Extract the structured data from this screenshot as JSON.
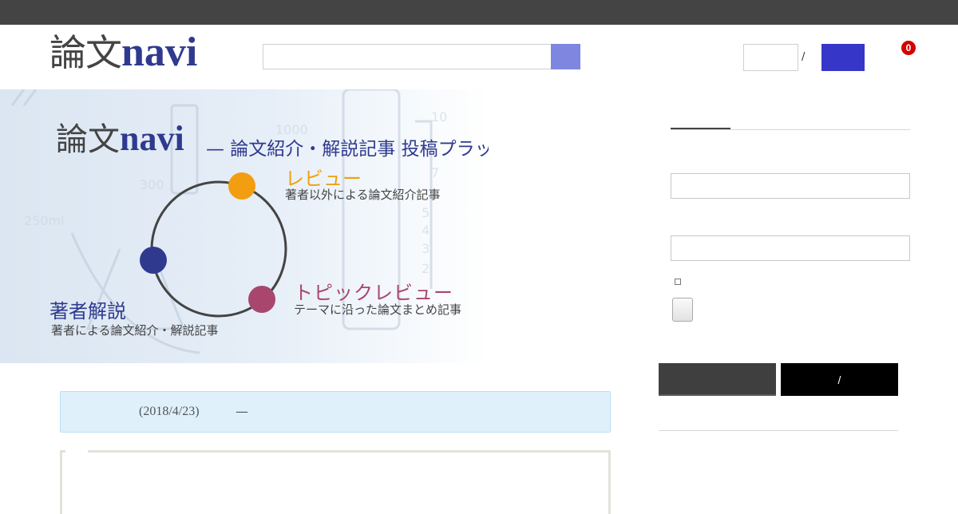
{
  "header": {
    "logo_kanji": "論文",
    "logo_latin": "navi",
    "search": {
      "placeholder": "",
      "value": ""
    },
    "login": {
      "separator": "/"
    },
    "notification_count": "0"
  },
  "banner": {
    "logo_kanji": "論文",
    "logo_latin": "navi",
    "tagline": "— 論文紹介・解説記事 投稿プラットフォーム",
    "cycle": [
      {
        "title": "レビュー",
        "subtitle": "著者以外による論文紹介記事",
        "color": "#F29E10"
      },
      {
        "title": "トピックレビュー",
        "subtitle": "テーマに沿った論文まとめ記事",
        "color": "#A8466E"
      },
      {
        "title": "著者解説",
        "subtitle": "著者による論文紹介・解説記事",
        "color": "#2F3A8F"
      }
    ]
  },
  "notice": {
    "date": "(2018/4/23)",
    "dash": "—"
  },
  "sidebar": {
    "buttons": {
      "right_label": "/"
    }
  },
  "colors": {
    "topbar": "#444444",
    "brand_blue": "#2F3A8F",
    "search_button": "#7F86E0",
    "login_button": "#3636C8",
    "badge": "#D40000",
    "notice_bg": "#DFF0FB"
  }
}
